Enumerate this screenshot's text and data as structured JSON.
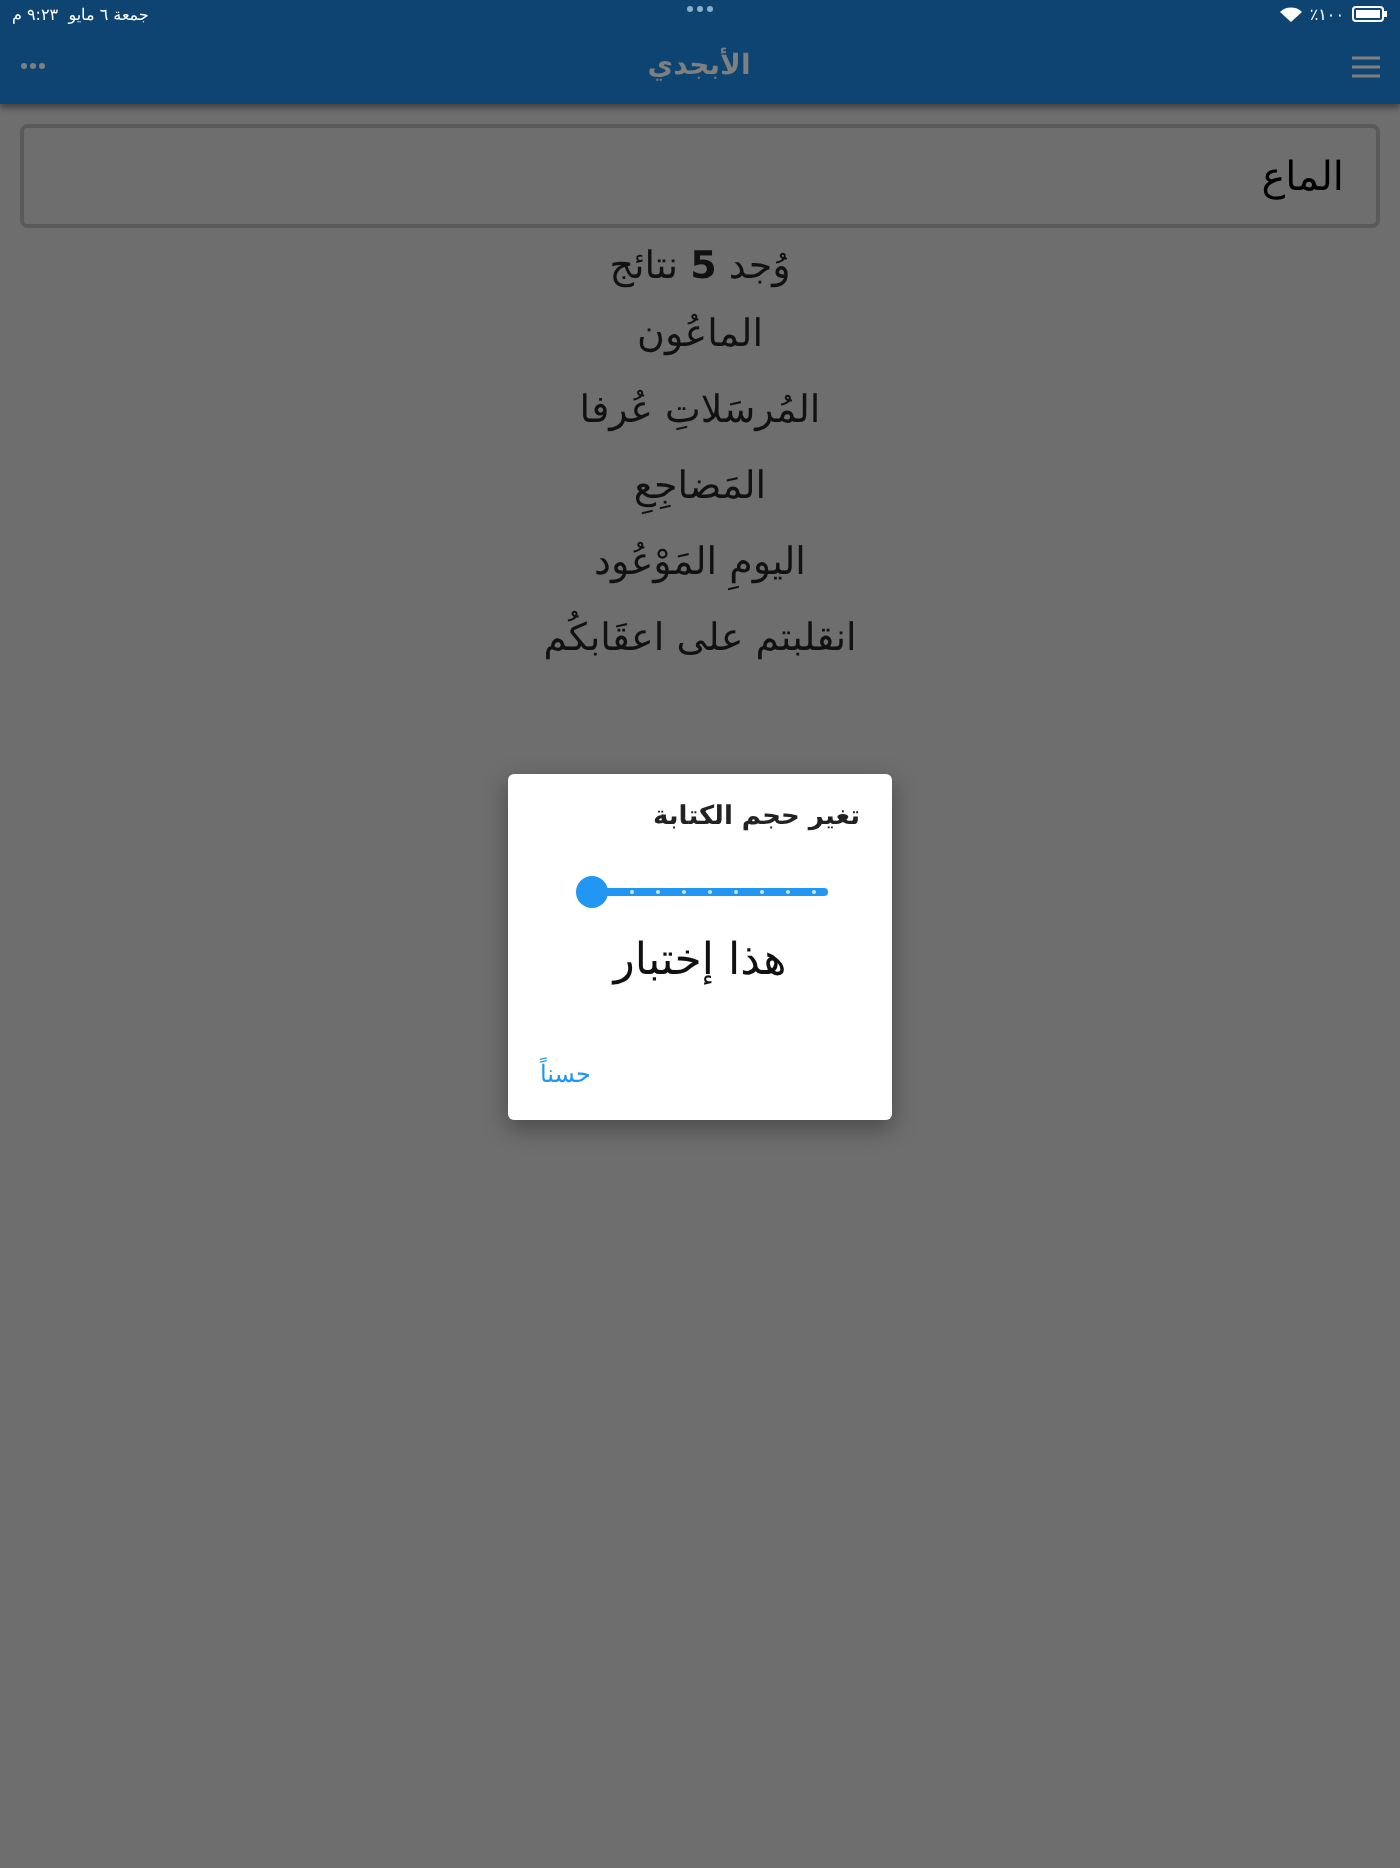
{
  "status_bar": {
    "date": "جمعة ٦ مايو",
    "time": "٩:٢٣ م",
    "battery": "٪١٠٠"
  },
  "nav_bar": {
    "title": "الأبجدي"
  },
  "search": {
    "value": "الماع"
  },
  "results": {
    "count_text": "وُجد **5** نتائج",
    "items": [
      "الماعُون",
      "المُرسَلاتِ عُرفا",
      "المَضاجِعِ",
      "اليومِ المَوْعُود",
      "انقلبتم على اعقَابكُم"
    ]
  },
  "dialog": {
    "title": "تغير حجم الكتابة",
    "slider": {
      "level": 0
    },
    "preview": "هذا إختبار",
    "button": "حسناً"
  }
}
